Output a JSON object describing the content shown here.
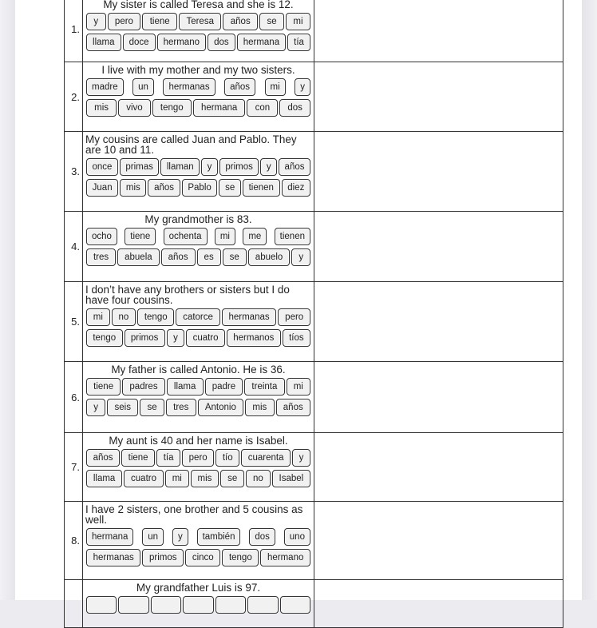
{
  "worksheet": {
    "rows": [
      {
        "number": "1.",
        "prompt": "My sister is called Teresa and she is 12.",
        "align": "center",
        "tiles": [
          [
            "y",
            "pero",
            "tiene",
            "Teresa",
            "años",
            "se",
            "mi"
          ],
          [
            "llama",
            "doce",
            "hermano",
            "dos",
            "hermana",
            "tía"
          ]
        ],
        "answer": ""
      },
      {
        "number": "2.",
        "prompt": "I live with my mother and my two sisters.",
        "align": "center",
        "tiles": [
          [
            "madre",
            "un",
            "hermanas",
            "años",
            "mi",
            "y"
          ],
          [
            "mis",
            "vivo",
            "tengo",
            "hermana",
            "con",
            "dos"
          ]
        ],
        "answer": ""
      },
      {
        "number": "3.",
        "prompt": "My cousins are called Juan and Pablo. They are 10 and 11.",
        "align": "left",
        "tiles": [
          [
            "once",
            "primas",
            "llaman",
            "y",
            "primos",
            "y",
            "años"
          ],
          [
            "Juan",
            "mis",
            "años",
            "Pablo",
            "se",
            "tienen",
            "diez"
          ]
        ],
        "answer": ""
      },
      {
        "number": "4.",
        "prompt": "My grandmother is 83.",
        "align": "center",
        "tiles": [
          [
            "ocho",
            "tiene",
            "ochenta",
            "mi",
            "me",
            "tienen"
          ],
          [
            "tres",
            "abuela",
            "años",
            "es",
            "se",
            "abuelo",
            "y"
          ]
        ],
        "answer": ""
      },
      {
        "number": "5.",
        "prompt": "I don’t have any brothers or sisters but I do have four cousins.",
        "align": "left",
        "tiles": [
          [
            "mi",
            "no",
            "tengo",
            "catorce",
            "hermanas",
            "pero"
          ],
          [
            "tengo",
            "primos",
            "y",
            "cuatro",
            "hermanos",
            "tíos"
          ]
        ],
        "answer": ""
      },
      {
        "number": "6.",
        "prompt": "My father is called Antonio.  He is 36.",
        "align": "center",
        "tiles": [
          [
            "tiene",
            "padres",
            "llama",
            "padre",
            "treinta",
            "mi"
          ],
          [
            "y",
            "seis",
            "se",
            "tres",
            "Antonio",
            "mis",
            "años"
          ]
        ],
        "answer": ""
      },
      {
        "number": "7.",
        "prompt": "My aunt is 40 and her name is Isabel.",
        "align": "center",
        "tiles": [
          [
            "años",
            "tiene",
            "tía",
            "pero",
            "tío",
            "cuarenta",
            "y"
          ],
          [
            "llama",
            "cuatro",
            "mi",
            "mis",
            "se",
            "no",
            "Isabel"
          ]
        ],
        "answer": ""
      },
      {
        "number": "8.",
        "prompt": "I have 2 sisters, one brother and 5 cousins as well.",
        "align": "left",
        "tiles": [
          [
            "hermana",
            "un",
            "y",
            "también",
            "dos",
            "uno"
          ],
          [
            "hermanas",
            "primos",
            "cinco",
            "tengo",
            "hermano"
          ]
        ],
        "answer": ""
      },
      {
        "number": "",
        "prompt": "My grandfather Luis is 97.",
        "align": "center",
        "tiles": [
          [
            "",
            "",
            "",
            "",
            "",
            "",
            ""
          ]
        ],
        "answer": ""
      }
    ]
  }
}
